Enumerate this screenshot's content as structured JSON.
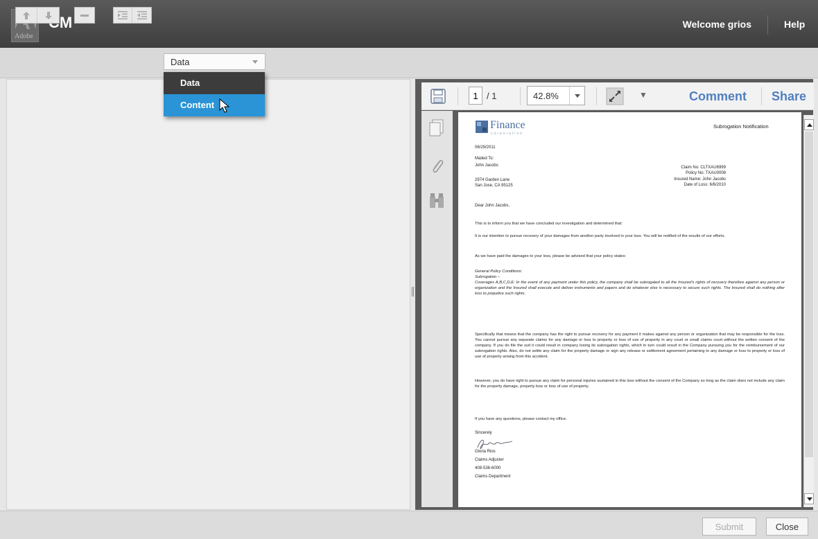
{
  "header": {
    "logo_text": "Adobe",
    "app_name": "CM",
    "welcome": "Welcome grios",
    "help": "Help"
  },
  "toolbar": {
    "select_value": "Data",
    "buttons": [
      "move-up-icon",
      "move-down-icon",
      "remove-icon",
      "indent-icon",
      "outdent-icon"
    ]
  },
  "dropdown": {
    "items": [
      "Data",
      "Content"
    ],
    "selected": "Content"
  },
  "viewer": {
    "page_current": "1",
    "page_total": "/ 1",
    "zoom": "42.8%",
    "comment": "Comment",
    "share": "Share"
  },
  "document": {
    "brand": "Finance",
    "brand_sub": "corporation",
    "title": "Subrogation Notification",
    "date": "06/29/2011",
    "mailed_to": "Mailed To:",
    "recipient": "John Jacobs",
    "address1": "2974 Garden Lane",
    "address2": "San Jose, CA 95125",
    "claim_no": "Claim No: CLTXAU6999",
    "policy_no": "Policy No: TXAU0008",
    "insured_name": "Insured Name: John Jacobs",
    "date_of_loss": "Date of Loss: 6/6/2010",
    "greeting": "Dear John Jacobs,",
    "p1": "This is to inform you that we have concluded our investigation and determined that:",
    "p2": "It is our intention to pursue recovery of your damages from another party involved in your loss. You will be notified of the results of our efforts.",
    "p3": "As we have paid the damages to your loss, please be advised that your policy states:",
    "p4_title": "General Policy Conditions:",
    "p4_sub": "Subrogation –",
    "p4_body": "Coverages A,B,C,D,E: In the event of any payment under this policy, the company shall be subrogated to all the Insured's rights of recovery therefore against any person or organization and the Insured shall execute and deliver instruments and papers and do whatever else is necessary to secure such rights. The Insured shall do nothing after loss to prejudice such rights.",
    "p5": "Specifically that means that the company has the right to pursue recovery for any payment it makes against any person or organization that may be responsible for the loss. You cannot pursue any separate claims for any damage or loss to property or loss of use of property in any court or small claims court without the written consent of the company. If you do file the suit it could result in company losing its subrogation rights, which in turn could result in the Company pursuing you for the reimbursement of our subrogation rights. Also, do not settle any claim for the property damage or sign any release or settlement agreement pertaining to any damage or loss to property or loss of use of property arising from this accident.",
    "p6": "However, you do have right to pursue any claim for personal injuries sustained in this loss without the consent of the Company so long as the claim does not include any claim for the property damage, property loss or loss of use of property.",
    "p7": "If you have any questions, please contact my office.",
    "closing": "Sincerely",
    "signer": "Gloria Rios",
    "signer_title": "Claims Adjuster",
    "phone": "408-536-6000",
    "department": "Claims Department"
  },
  "footer": {
    "submit": "Submit",
    "close": "Close"
  }
}
